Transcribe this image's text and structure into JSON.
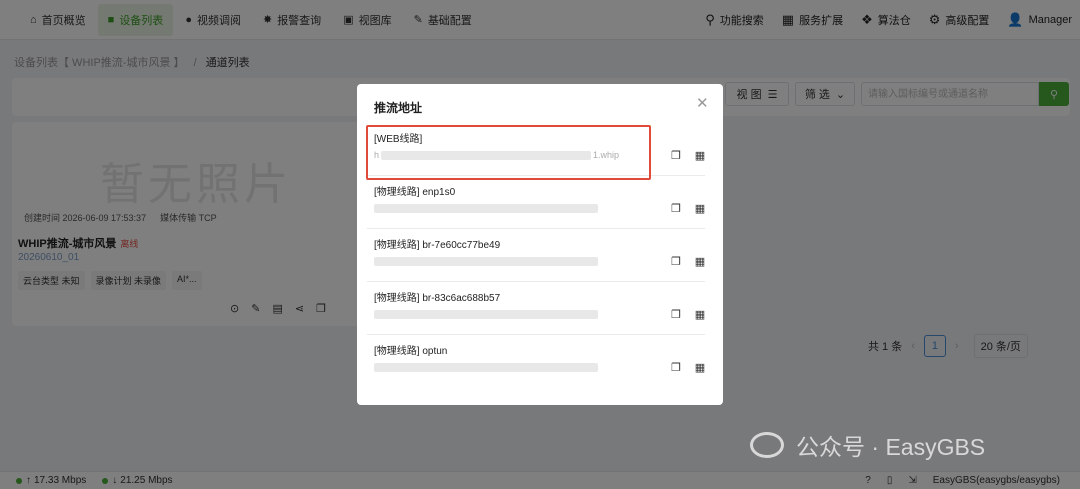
{
  "nav": {
    "items": [
      {
        "label": "首页概览",
        "icon": "home-icon",
        "glyph": "⌂"
      },
      {
        "label": "设备列表",
        "icon": "device-icon",
        "glyph": "■",
        "active": true
      },
      {
        "label": "视频调阅",
        "icon": "video-icon",
        "glyph": "●"
      },
      {
        "label": "报警查询",
        "icon": "alarm-icon",
        "glyph": "✸"
      },
      {
        "label": "视图库",
        "icon": "image-icon",
        "glyph": "▣"
      },
      {
        "label": "基础配置",
        "icon": "edit-icon",
        "glyph": "✎"
      }
    ],
    "right": [
      {
        "label": "功能搜索",
        "icon": "search-icon",
        "glyph": "⚲"
      },
      {
        "label": "服务扩展",
        "icon": "grid-icon",
        "glyph": "▦"
      },
      {
        "label": "算法仓",
        "icon": "dropbox-icon",
        "glyph": "❖"
      },
      {
        "label": "高级配置",
        "icon": "gear-icon",
        "glyph": "⚙"
      },
      {
        "label": "Manager",
        "icon": "user-icon",
        "glyph": "👤"
      }
    ]
  },
  "breadcrumb": {
    "parent": "设备列表【 WHIP推流-城市风景 】",
    "sep": "/",
    "current": "通道列表"
  },
  "toolbar": {
    "view_label": "视 图",
    "filter_label": "筛 选",
    "search_placeholder": "请输入国标编号或通道名称"
  },
  "card": {
    "no_photo": "暂无照片",
    "created": "创建时间 2026-06-09 17:53:37",
    "transport": "媒体传输 TCP",
    "name": "WHIP推流-城市风景",
    "status": "离线",
    "id": "20260610_01",
    "tags": [
      "云台类型 未知",
      "录像计划 未录像",
      "AI*..."
    ]
  },
  "pager": {
    "total": "共 1 条",
    "page": "1",
    "page_size": "20 条/页"
  },
  "status": {
    "up": "17.33 Mbps",
    "down": "21.25 Mbps",
    "app": "EasyGBS(easygbs/easygbs)"
  },
  "modal": {
    "title": "推流地址",
    "routes": [
      {
        "label": "[WEB线路]",
        "url_prefix": "h",
        "url_suffix": "1.whip"
      },
      {
        "label": "[物理线路]  enp1s0",
        "url_prefix": "",
        "url_suffix": ""
      },
      {
        "label": "[物理线路]  br-7e60cc77be49",
        "url_prefix": "",
        "url_suffix": ""
      },
      {
        "label": "[物理线路]  br-83c6ac688b57",
        "url_prefix": "",
        "url_suffix": ""
      },
      {
        "label": "[物理线路]  optun",
        "url_prefix": "",
        "url_suffix": ""
      }
    ]
  },
  "watermark": {
    "text": "公众号 · EasyGBS"
  },
  "colors": {
    "accent": "#4cae3a",
    "highlight": "#e04a3a",
    "offline": "#e54d42"
  }
}
